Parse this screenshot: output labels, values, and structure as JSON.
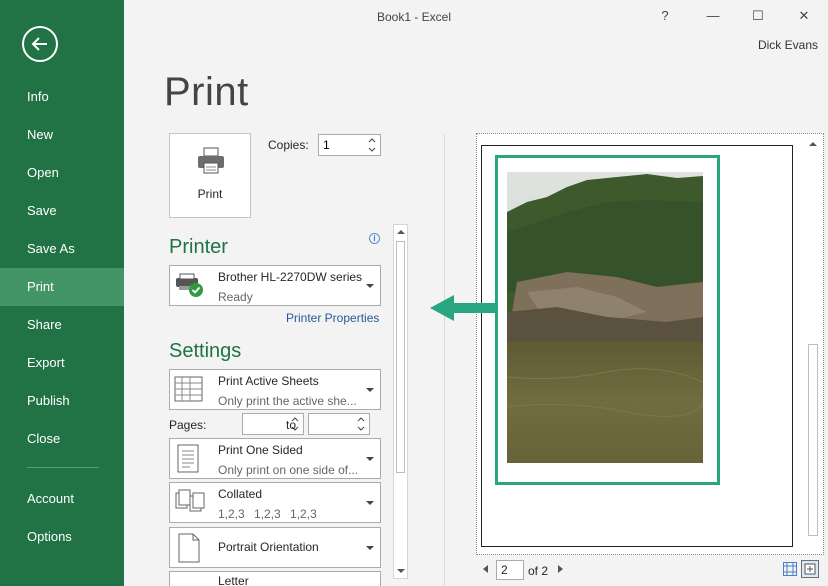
{
  "window": {
    "title": "Book1 - Excel",
    "help": "?",
    "minimize": "—",
    "maximize": "☐",
    "close": "✕",
    "user": "Dick Evans"
  },
  "sidebar": {
    "items": [
      {
        "label": "Info"
      },
      {
        "label": "New"
      },
      {
        "label": "Open"
      },
      {
        "label": "Save"
      },
      {
        "label": "Save As"
      },
      {
        "label": "Print"
      },
      {
        "label": "Share"
      },
      {
        "label": "Export"
      },
      {
        "label": "Publish"
      },
      {
        "label": "Close"
      },
      {
        "label": "Account"
      },
      {
        "label": "Options"
      }
    ],
    "active": "Print"
  },
  "page": {
    "heading": "Print"
  },
  "print": {
    "button_label": "Print",
    "copies_label": "Copies:",
    "copies_value": "1"
  },
  "printer": {
    "section": "Printer",
    "name": "Brother HL-2270DW series",
    "status": "Ready",
    "properties_link": "Printer Properties"
  },
  "settings": {
    "section": "Settings",
    "what": {
      "main": "Print Active Sheets",
      "sub": "Only print the active she..."
    },
    "pages_label": "Pages:",
    "pages_to": "to",
    "pages_from_value": "",
    "pages_to_value": "",
    "sides": {
      "main": "Print One Sided",
      "sub": "Only print on one side of..."
    },
    "collation": {
      "main": "Collated",
      "sub": "1,2,3    1,2,3    1,2,3"
    },
    "orientation": {
      "main": "Portrait Orientation"
    },
    "paper": {
      "main": "Letter"
    }
  },
  "preview": {
    "current_page": "2",
    "of_pages": "of 2"
  },
  "colors": {
    "sidebar": "#217346",
    "sidebar_active": "#439467",
    "accent": "#2aa582",
    "link": "#2b579a"
  }
}
